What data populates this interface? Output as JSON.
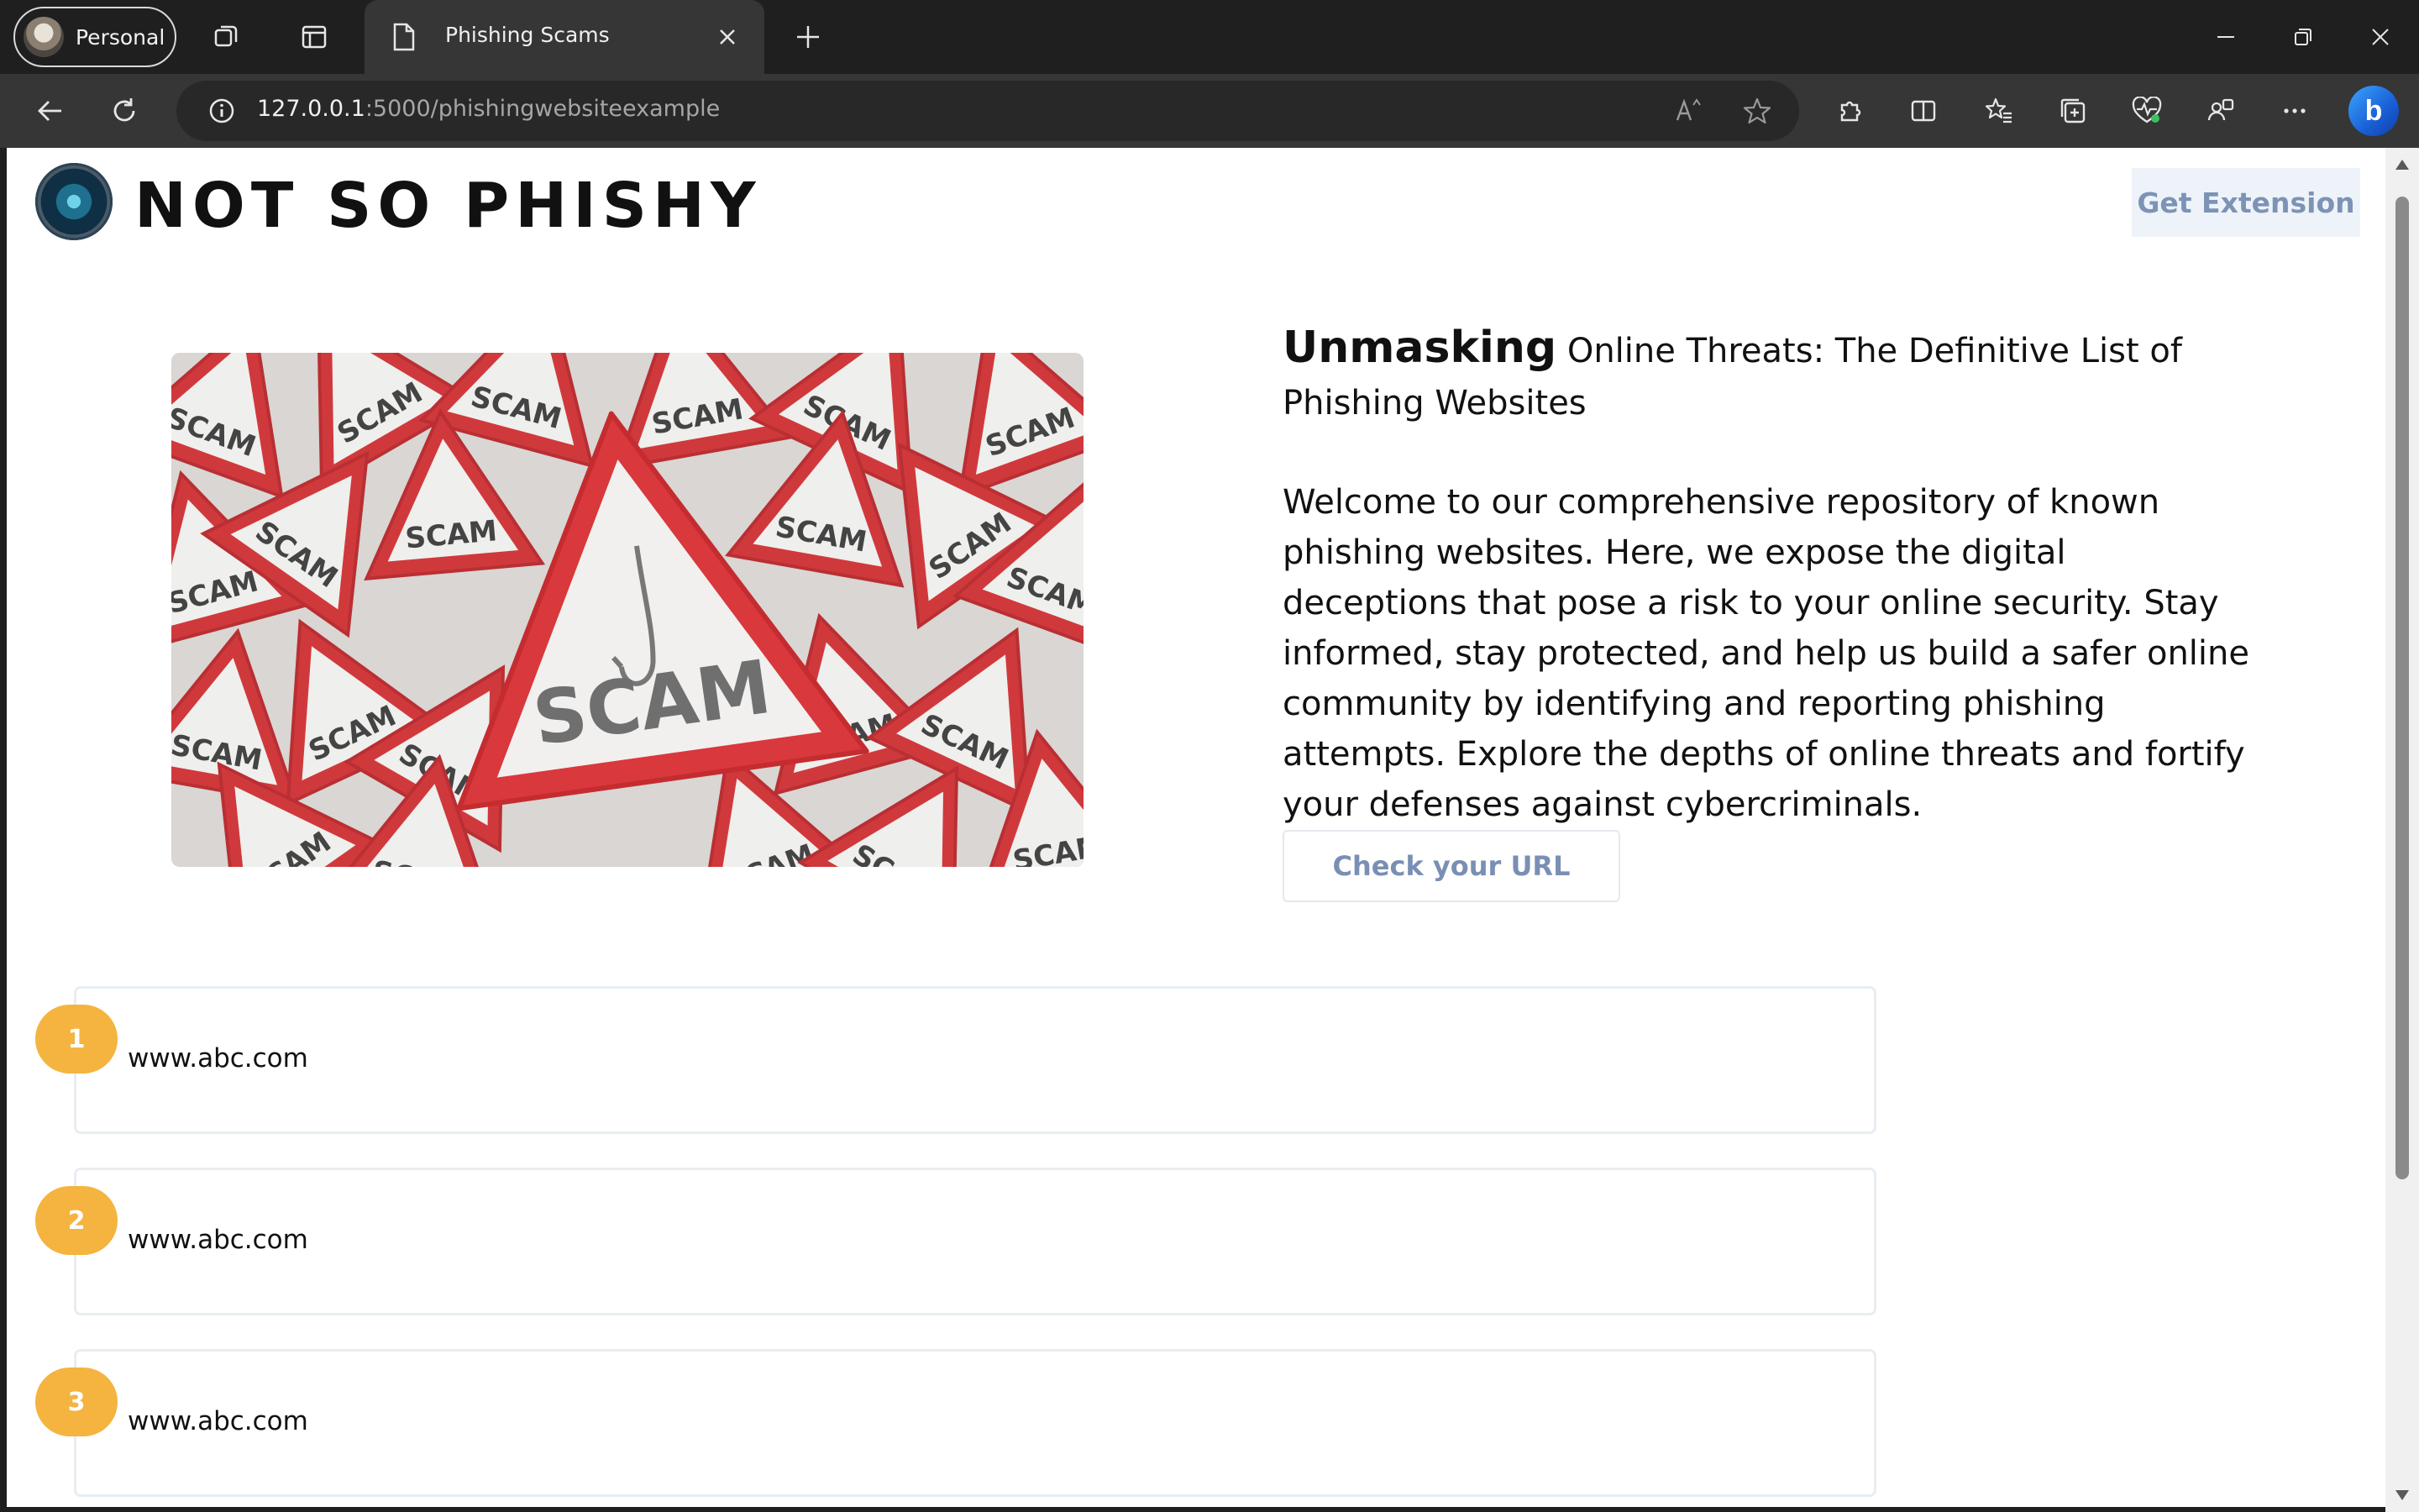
{
  "browser": {
    "profile_label": "Personal",
    "tab_title": "Phishing Scams",
    "url_host": "127.0.0.1",
    "url_path": ":5000/phishingwebsiteexample"
  },
  "page": {
    "brand": "NOT SO PHISHY",
    "get_extension_label": "Get Extension",
    "headline_strong": "Unmasking",
    "headline_rest": " Online Threats: The Definitive List of Phishing Websites",
    "intro": "Welcome to our comprehensive repository of known phishing websites. Here, we expose the digital deceptions that pose a risk to your online security. Stay informed, stay protected, and help us build a safer online community by identifying and reporting phishing attempts. Explore the depths of online threats and fortify your defenses against cybercriminals.",
    "check_url_label": "Check your URL",
    "hero_sign_text": "SCAM",
    "sites": [
      {
        "num": "1",
        "url": "www.abc.com"
      },
      {
        "num": "2",
        "url": "www.abc.com"
      },
      {
        "num": "3",
        "url": "www.abc.com"
      }
    ],
    "accent_color": "#f4b43f"
  }
}
